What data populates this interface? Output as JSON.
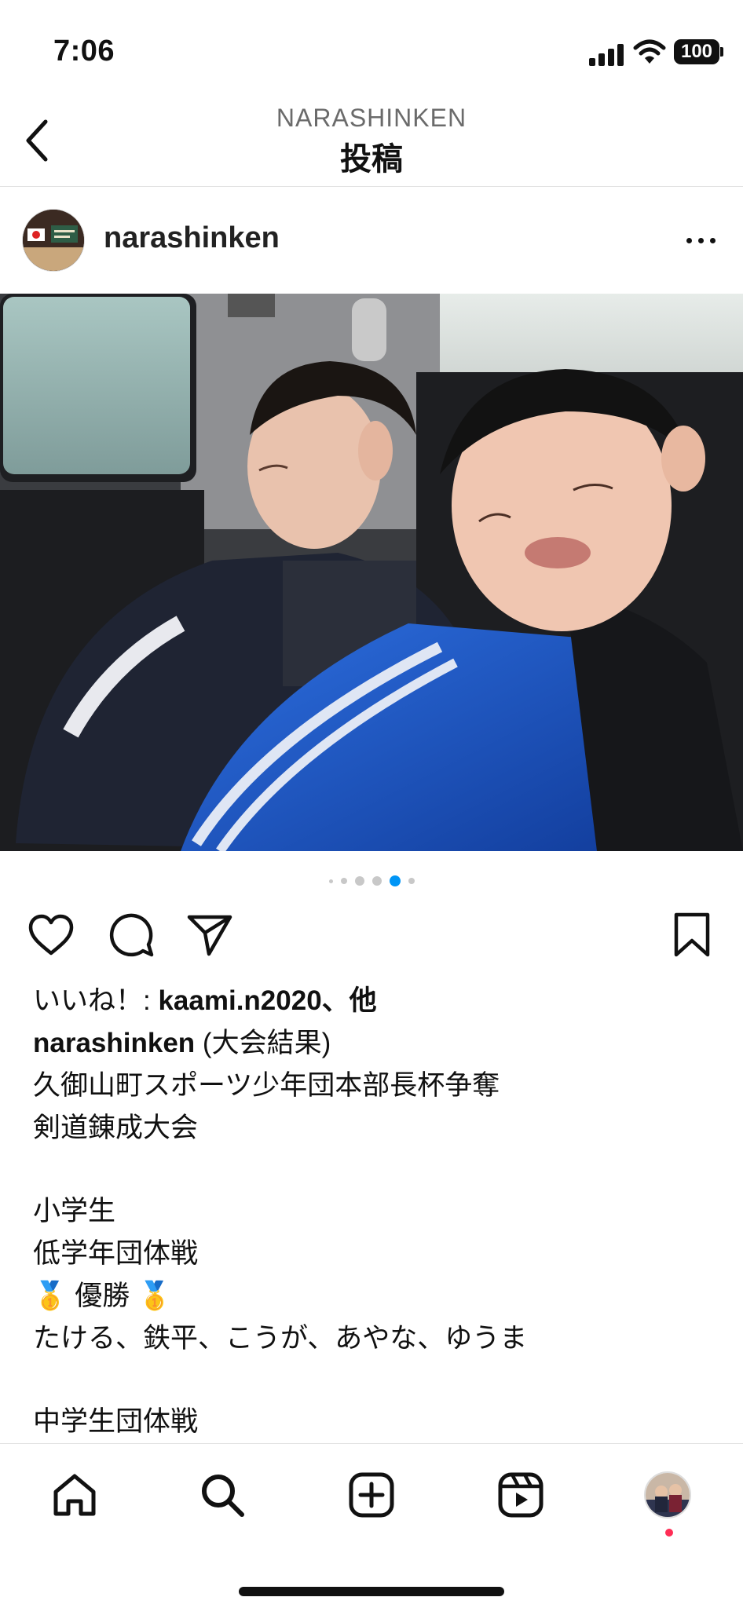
{
  "status_bar": {
    "time": "7:06",
    "battery": "100"
  },
  "header": {
    "account": "NARASHINKEN",
    "title": "投稿"
  },
  "post": {
    "username": "narashinken",
    "carousel": {
      "count": 6,
      "active_index": 4
    },
    "liked_by_prefix": "いいね！: ",
    "liked_by_names": "kaami.n2020、他",
    "caption_user": "narashinken",
    "caption_first": " (大会結果)",
    "caption_lines": [
      "久御山町スポーツ少年団本部長杯争奪",
      "剣道錬成大会",
      "",
      "小学生",
      "低学年団体戦",
      "🥇 優勝 🥇",
      "たける、鉄平、こうが、あやな、ゆうま",
      "",
      "中学生団体戦"
    ]
  },
  "icons": {
    "back": "chevron-left-icon",
    "more": "more-horizontal-icon",
    "like": "heart-icon",
    "comment": "comment-icon",
    "share": "paper-plane-icon",
    "save": "bookmark-icon",
    "home": "home-icon",
    "search": "search-icon",
    "create": "plus-square-icon",
    "reels": "reels-icon",
    "profile": "profile-avatar"
  },
  "colors": {
    "active_dot": "#0095f6",
    "notification": "#ff2d55"
  }
}
